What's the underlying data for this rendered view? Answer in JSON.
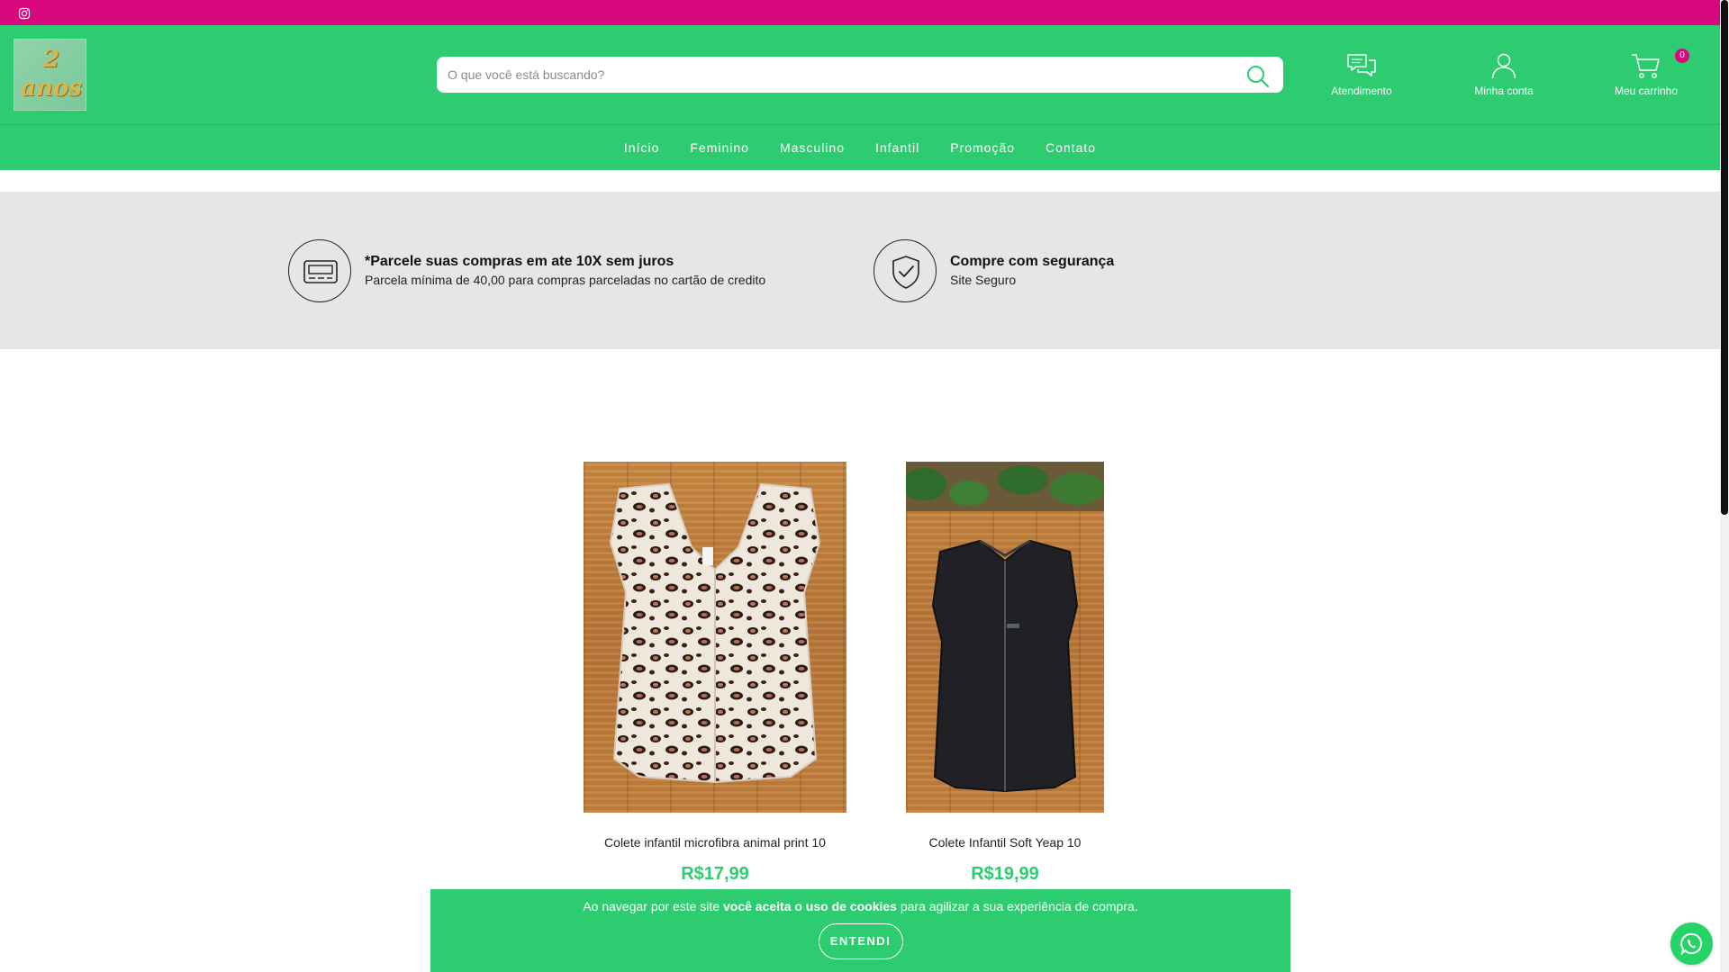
{
  "topbar": {
    "social_icon": "instagram-icon",
    "color": "#d9087f"
  },
  "brand": {
    "logo_line1": "2",
    "logo_line2": "anos",
    "logo_text": "2 anos"
  },
  "search": {
    "placeholder": "O que você está buscando?",
    "icon": "search-icon"
  },
  "header_actions": {
    "service_label": "Atendimento",
    "account_label": "Minha conta",
    "cart_label": "Meu carrinho",
    "cart_count": "0"
  },
  "nav": {
    "items": [
      {
        "label": "Início"
      },
      {
        "label": "Feminino"
      },
      {
        "label": "Masculino"
      },
      {
        "label": "Infantil"
      },
      {
        "label": "Promoção"
      },
      {
        "label": "Contato"
      }
    ]
  },
  "info": {
    "installments": {
      "title": "*Parcele suas compras em ate 10X sem juros",
      "subtitle": "Parcela mínima de 40,00 para compras parceladas no cartão de credito",
      "icon": "credit-card-icon"
    },
    "security": {
      "title": "Compre com segurança",
      "subtitle": "Site Seguro",
      "icon": "shield-check-icon"
    }
  },
  "products": [
    {
      "name": "Colete infantil microfibra animal print 10",
      "price": "R$17,99"
    },
    {
      "name": "Colete Infantil Soft Yeap 10",
      "price": "R$19,99"
    }
  ],
  "cookie": {
    "text_before": "Ao navegar por este site ",
    "text_bold": "você aceita o uso de cookies",
    "text_after": " para agilizar a sua experiência de compra.",
    "button_label": "ENTENDI"
  },
  "colors": {
    "brand_green": "#2ecc71",
    "accent_pink": "#d9087f",
    "info_bg": "#e6e6e6"
  }
}
